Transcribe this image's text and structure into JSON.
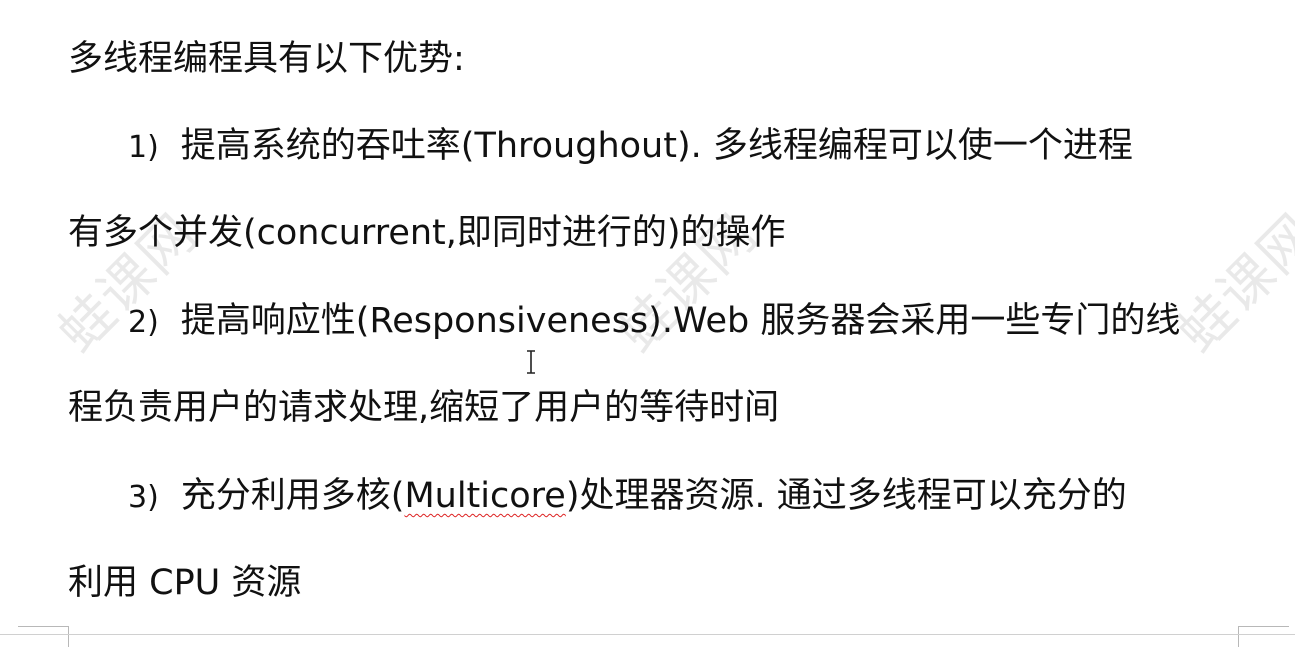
{
  "document": {
    "heading": "多线程编程具有以下优势:",
    "items": [
      {
        "number": "1)",
        "line1": "提高系统的吞吐率(Throughout). 多线程编程可以使一个进程",
        "line2": "有多个并发(concurrent,即同时进行的)的操作"
      },
      {
        "number": "2)",
        "line1": "提高响应性(Responsiveness).Web 服务器会采用一些专门的线",
        "line2": "程负责用户的请求处理,缩短了用户的等待时间"
      },
      {
        "number": "3)",
        "line1_pre": "充分利用多核(",
        "line1_misspelled": "Multicore",
        "line1_post": ")处理器资源. 通过多线程可以充分的",
        "line2": "利用 CPU 资源"
      }
    ]
  },
  "watermark": {
    "text": "蛙课网"
  },
  "colors": {
    "text": "#111111",
    "spellcheck": "#dd2222",
    "watermark": "rgba(0,0,0,0.085)"
  },
  "icons": {
    "cursor": "text-i-beam-cursor-icon"
  }
}
